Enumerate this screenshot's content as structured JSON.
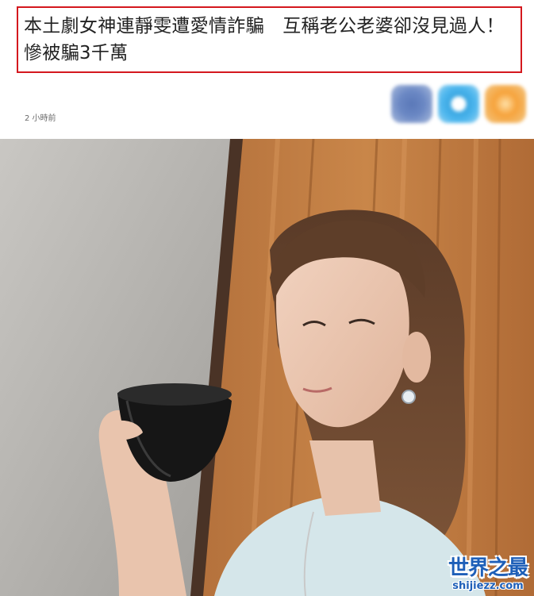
{
  "article": {
    "headline": "本土劇女神連靜雯遭愛情詐騙　互稱老公老婆卻沒見過人！慘被騙3千萬",
    "timestamp": "2 小時前"
  },
  "share": {
    "icons": [
      "facebook-icon",
      "line-icon",
      "more-share-icon"
    ]
  },
  "watermark": {
    "logo": "世界之最",
    "url": "shijiezz.com"
  },
  "colors": {
    "headline_border": "#d4181e",
    "watermark": "#1e5fb8"
  }
}
